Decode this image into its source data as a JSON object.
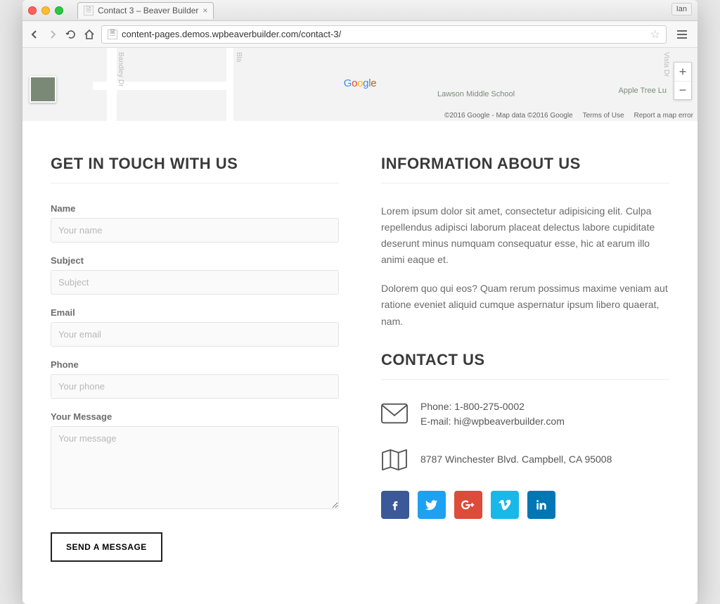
{
  "browser": {
    "tab_title": "Contact 3 – Beaver Builder",
    "profile_name": "Ian",
    "url": "content-pages.demos.wpbeaverbuilder.com/contact-3/"
  },
  "map": {
    "poi1": "Lawson Middle School",
    "poi2": "Apple Tree Lu",
    "road_label1": "Bandley Dr",
    "road_label2": "Bla",
    "road_label3": "Vista Dr",
    "attrib_copyright": "©2016 Google - Map data ©2016 Google",
    "attrib_terms": "Terms of Use",
    "attrib_report": "Report a map error"
  },
  "form": {
    "heading": "GET IN TOUCH WITH US",
    "name_label": "Name",
    "name_placeholder": "Your name",
    "subject_label": "Subject",
    "subject_placeholder": "Subject",
    "email_label": "Email",
    "email_placeholder": "Your email",
    "phone_label": "Phone",
    "phone_placeholder": "Your phone",
    "message_label": "Your Message",
    "message_placeholder": "Your message",
    "submit": "SEND A MESSAGE"
  },
  "about": {
    "heading": "INFORMATION ABOUT US",
    "p1": "Lorem ipsum dolor sit amet, consectetur adipisicing elit. Culpa repellendus adipisci laborum placeat delectus labore cupiditate deserunt minus numquam consequatur esse, hic at earum illo animi eaque et.",
    "p2": "Dolorem quo qui eos? Quam rerum possimus maxime veniam aut ratione eveniet aliquid cumque aspernatur ipsum libero quaerat, nam."
  },
  "contact": {
    "heading": "CONTACT US",
    "phone": "Phone: 1-800-275-0002",
    "email": "E-mail: hi@wpbeaverbuilder.com",
    "address": "8787 Winchester Blvd. Campbell, CA 95008"
  }
}
